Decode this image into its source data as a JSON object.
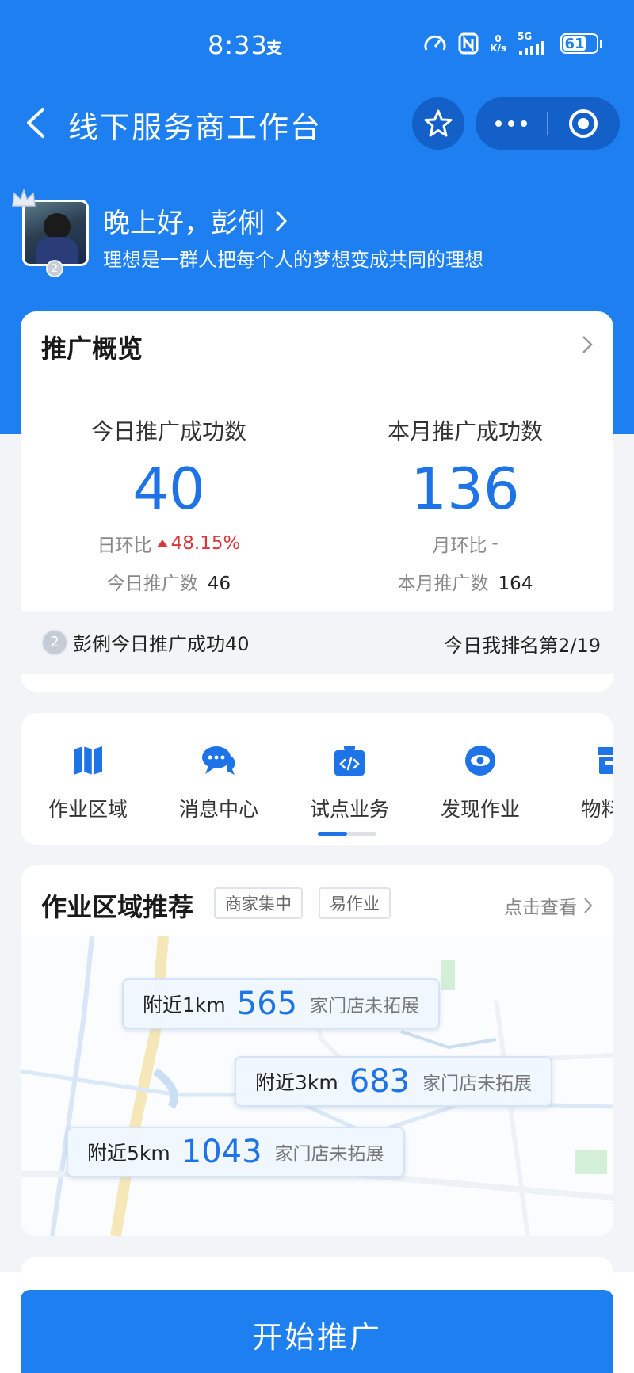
{
  "status_bar": {
    "time": "8:33",
    "pay_glyph": "支",
    "net_speed_top": "0",
    "net_speed_unit": "K/s",
    "network": "5G",
    "battery": "61"
  },
  "header": {
    "title": "线下服务商工作台"
  },
  "user": {
    "greeting": "晚上好，彭俐",
    "motto": "理想是一群人把每个人的梦想变成共同的理想",
    "level": "2"
  },
  "overview": {
    "title": "推广概览",
    "today": {
      "label": "今日推广成功数",
      "value": "40",
      "compare_label": "日环比",
      "compare_value": "48.15%",
      "count_label": "今日推广数",
      "count_value": "46"
    },
    "month": {
      "label": "本月推广成功数",
      "value": "136",
      "compare_label": "月环比",
      "compare_value": "-",
      "count_label": "本月推广数",
      "count_value": "164"
    },
    "rank": {
      "badge": "2",
      "text": "彭俐今日推广成功40",
      "position": "今日我排名第2/19"
    }
  },
  "nav": {
    "items": [
      {
        "label": "作业区域",
        "icon": "book-map-icon"
      },
      {
        "label": "消息中心",
        "icon": "chat-bubbles-icon"
      },
      {
        "label": "试点业务",
        "icon": "code-box-icon"
      },
      {
        "label": "发现作业",
        "icon": "eye-icon"
      },
      {
        "label": "物料中",
        "icon": "materials-icon"
      }
    ],
    "scroll_progress": 0.5
  },
  "area": {
    "title": "作业区域推荐",
    "tags": [
      "商家集中",
      "易作业"
    ],
    "more": "点击查看",
    "pills": [
      {
        "distance": "附近1km",
        "count": "565",
        "desc": "家门店未拓展"
      },
      {
        "distance": "附近3km",
        "count": "683",
        "desc": "家门店未拓展"
      },
      {
        "distance": "附近5km",
        "count": "1043",
        "desc": "家门店未拓展"
      }
    ]
  },
  "cta": {
    "label": "开始推广"
  },
  "colors": {
    "primary": "#1e80f0",
    "accent_number": "#1e74e6",
    "up_red": "#d9353b"
  }
}
